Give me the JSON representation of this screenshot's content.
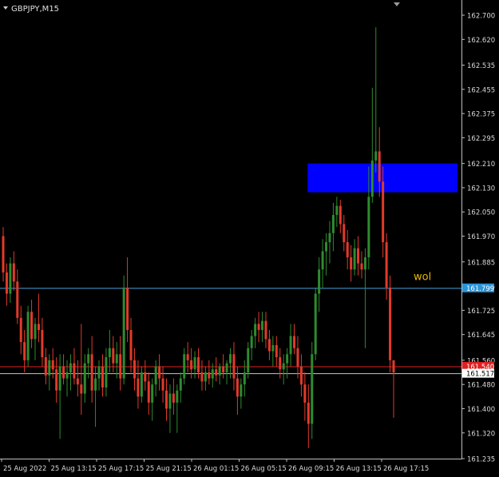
{
  "window": {
    "symbol_title": "GBPJPY,M15"
  },
  "colors": {
    "background": "#000000",
    "axis": "#c0c0c0",
    "bull": "#2e8b2e",
    "bear": "#e23a2a",
    "zone": "#0000ff",
    "hline_blue": "#4aa3df",
    "hline_red": "#e02020",
    "hline_white": "#c8c8c8",
    "annotation": "#e8b800"
  },
  "chart_data": {
    "type": "candlestick",
    "title": "GBPJPY,M15",
    "x_tick_labels": [
      "25 Aug 2022",
      "25 Aug 13:15",
      "25 Aug 17:15",
      "25 Aug 21:15",
      "26 Aug 01:15",
      "26 Aug 05:15",
      "26 Aug 09:15",
      "26 Aug 13:15",
      "26 Aug 17:15"
    ],
    "y_tick_labels": [
      "162.700",
      "162.620",
      "162.535",
      "162.455",
      "162.375",
      "162.295",
      "162.210",
      "162.130",
      "162.050",
      "161.970",
      "161.885",
      "161.805",
      "161.725",
      "161.645",
      "161.560",
      "161.480",
      "161.400",
      "161.320",
      "161.235"
    ],
    "ylim": [
      161.235,
      162.7
    ],
    "grid": false,
    "zone": {
      "y_top": 162.21,
      "y_bottom": 162.115,
      "from_index": 86,
      "to_end": true
    },
    "price_lines": [
      {
        "name": "level-blue",
        "value": 161.799,
        "label": "161.799",
        "color_key": "hline_blue"
      },
      {
        "name": "level-red",
        "value": 161.54,
        "label": "161.540",
        "color_key": "hline_red"
      },
      {
        "name": "level-white",
        "value": 161.517,
        "label": "161.517",
        "color_key": "hline_white"
      }
    ],
    "annotation": {
      "text": "wol",
      "value": 161.83,
      "index": 124
    },
    "candles": [
      {
        "o": 161.97,
        "h": 162.0,
        "l": 161.82,
        "c": 161.85
      },
      {
        "o": 161.85,
        "h": 161.88,
        "l": 161.74,
        "c": 161.78
      },
      {
        "o": 161.78,
        "h": 161.9,
        "l": 161.75,
        "c": 161.88
      },
      {
        "o": 161.88,
        "h": 161.92,
        "l": 161.79,
        "c": 161.82
      },
      {
        "o": 161.82,
        "h": 161.86,
        "l": 161.68,
        "c": 161.7
      },
      {
        "o": 161.7,
        "h": 161.74,
        "l": 161.58,
        "c": 161.62
      },
      {
        "o": 161.62,
        "h": 161.66,
        "l": 161.52,
        "c": 161.56
      },
      {
        "o": 161.56,
        "h": 161.74,
        "l": 161.54,
        "c": 161.72
      },
      {
        "o": 161.72,
        "h": 161.76,
        "l": 161.6,
        "c": 161.63
      },
      {
        "o": 161.63,
        "h": 161.7,
        "l": 161.56,
        "c": 161.68
      },
      {
        "o": 161.68,
        "h": 161.78,
        "l": 161.62,
        "c": 161.66
      },
      {
        "o": 161.66,
        "h": 161.7,
        "l": 161.54,
        "c": 161.57
      },
      {
        "o": 161.57,
        "h": 161.6,
        "l": 161.48,
        "c": 161.51
      },
      {
        "o": 161.51,
        "h": 161.58,
        "l": 161.46,
        "c": 161.56
      },
      {
        "o": 161.56,
        "h": 161.6,
        "l": 161.5,
        "c": 161.53
      },
      {
        "o": 161.53,
        "h": 161.57,
        "l": 161.42,
        "c": 161.46
      },
      {
        "o": 161.46,
        "h": 161.58,
        "l": 161.3,
        "c": 161.54
      },
      {
        "o": 161.54,
        "h": 161.58,
        "l": 161.48,
        "c": 161.5
      },
      {
        "o": 161.5,
        "h": 161.56,
        "l": 161.44,
        "c": 161.52
      },
      {
        "o": 161.52,
        "h": 161.58,
        "l": 161.46,
        "c": 161.55
      },
      {
        "o": 161.55,
        "h": 161.6,
        "l": 161.48,
        "c": 161.5
      },
      {
        "o": 161.5,
        "h": 161.56,
        "l": 161.44,
        "c": 161.48
      },
      {
        "o": 161.48,
        "h": 161.68,
        "l": 161.38,
        "c": 161.45
      },
      {
        "o": 161.45,
        "h": 161.58,
        "l": 161.42,
        "c": 161.55
      },
      {
        "o": 161.55,
        "h": 161.6,
        "l": 161.5,
        "c": 161.58
      },
      {
        "o": 161.58,
        "h": 161.64,
        "l": 161.42,
        "c": 161.46
      },
      {
        "o": 161.46,
        "h": 161.54,
        "l": 161.34,
        "c": 161.5
      },
      {
        "o": 161.5,
        "h": 161.56,
        "l": 161.46,
        "c": 161.54
      },
      {
        "o": 161.54,
        "h": 161.58,
        "l": 161.44,
        "c": 161.47
      },
      {
        "o": 161.47,
        "h": 161.6,
        "l": 161.44,
        "c": 161.57
      },
      {
        "o": 161.57,
        "h": 161.66,
        "l": 161.52,
        "c": 161.6
      },
      {
        "o": 161.6,
        "h": 161.64,
        "l": 161.52,
        "c": 161.55
      },
      {
        "o": 161.55,
        "h": 161.62,
        "l": 161.5,
        "c": 161.58
      },
      {
        "o": 161.58,
        "h": 161.64,
        "l": 161.46,
        "c": 161.5
      },
      {
        "o": 161.5,
        "h": 161.84,
        "l": 161.48,
        "c": 161.8
      },
      {
        "o": 161.8,
        "h": 161.9,
        "l": 161.62,
        "c": 161.66
      },
      {
        "o": 161.66,
        "h": 161.7,
        "l": 161.52,
        "c": 161.56
      },
      {
        "o": 161.56,
        "h": 161.6,
        "l": 161.46,
        "c": 161.5
      },
      {
        "o": 161.5,
        "h": 161.56,
        "l": 161.4,
        "c": 161.44
      },
      {
        "o": 161.44,
        "h": 161.54,
        "l": 161.42,
        "c": 161.52
      },
      {
        "o": 161.52,
        "h": 161.56,
        "l": 161.46,
        "c": 161.49
      },
      {
        "o": 161.49,
        "h": 161.52,
        "l": 161.38,
        "c": 161.42
      },
      {
        "o": 161.42,
        "h": 161.5,
        "l": 161.36,
        "c": 161.48
      },
      {
        "o": 161.48,
        "h": 161.56,
        "l": 161.44,
        "c": 161.54
      },
      {
        "o": 161.54,
        "h": 161.58,
        "l": 161.46,
        "c": 161.5
      },
      {
        "o": 161.5,
        "h": 161.54,
        "l": 161.42,
        "c": 161.46
      },
      {
        "o": 161.46,
        "h": 161.5,
        "l": 161.36,
        "c": 161.4
      },
      {
        "o": 161.4,
        "h": 161.48,
        "l": 161.32,
        "c": 161.45
      },
      {
        "o": 161.45,
        "h": 161.5,
        "l": 161.38,
        "c": 161.42
      },
      {
        "o": 161.42,
        "h": 161.48,
        "l": 161.32,
        "c": 161.46
      },
      {
        "o": 161.46,
        "h": 161.52,
        "l": 161.42,
        "c": 161.5
      },
      {
        "o": 161.5,
        "h": 161.6,
        "l": 161.48,
        "c": 161.58
      },
      {
        "o": 161.58,
        "h": 161.62,
        "l": 161.52,
        "c": 161.56
      },
      {
        "o": 161.56,
        "h": 161.6,
        "l": 161.5,
        "c": 161.53
      },
      {
        "o": 161.53,
        "h": 161.59,
        "l": 161.5,
        "c": 161.57
      },
      {
        "o": 161.57,
        "h": 161.6,
        "l": 161.5,
        "c": 161.52
      },
      {
        "o": 161.52,
        "h": 161.56,
        "l": 161.46,
        "c": 161.49
      },
      {
        "o": 161.49,
        "h": 161.54,
        "l": 161.46,
        "c": 161.52
      },
      {
        "o": 161.52,
        "h": 161.56,
        "l": 161.48,
        "c": 161.5
      },
      {
        "o": 161.5,
        "h": 161.55,
        "l": 161.47,
        "c": 161.53
      },
      {
        "o": 161.53,
        "h": 161.57,
        "l": 161.49,
        "c": 161.51
      },
      {
        "o": 161.51,
        "h": 161.55,
        "l": 161.48,
        "c": 161.54
      },
      {
        "o": 161.54,
        "h": 161.58,
        "l": 161.5,
        "c": 161.52
      },
      {
        "o": 161.52,
        "h": 161.56,
        "l": 161.48,
        "c": 161.55
      },
      {
        "o": 161.55,
        "h": 161.6,
        "l": 161.5,
        "c": 161.58
      },
      {
        "o": 161.58,
        "h": 161.62,
        "l": 161.46,
        "c": 161.5
      },
      {
        "o": 161.5,
        "h": 161.54,
        "l": 161.38,
        "c": 161.44
      },
      {
        "o": 161.44,
        "h": 161.5,
        "l": 161.4,
        "c": 161.48
      },
      {
        "o": 161.48,
        "h": 161.56,
        "l": 161.44,
        "c": 161.52
      },
      {
        "o": 161.52,
        "h": 161.62,
        "l": 161.5,
        "c": 161.6
      },
      {
        "o": 161.6,
        "h": 161.66,
        "l": 161.56,
        "c": 161.64
      },
      {
        "o": 161.64,
        "h": 161.7,
        "l": 161.6,
        "c": 161.68
      },
      {
        "o": 161.68,
        "h": 161.72,
        "l": 161.62,
        "c": 161.66
      },
      {
        "o": 161.66,
        "h": 161.72,
        "l": 161.62,
        "c": 161.69
      },
      {
        "o": 161.69,
        "h": 161.72,
        "l": 161.6,
        "c": 161.63
      },
      {
        "o": 161.63,
        "h": 161.66,
        "l": 161.56,
        "c": 161.59
      },
      {
        "o": 161.59,
        "h": 161.64,
        "l": 161.54,
        "c": 161.61
      },
      {
        "o": 161.61,
        "h": 161.64,
        "l": 161.54,
        "c": 161.57
      },
      {
        "o": 161.57,
        "h": 161.6,
        "l": 161.5,
        "c": 161.53
      },
      {
        "o": 161.53,
        "h": 161.58,
        "l": 161.48,
        "c": 161.55
      },
      {
        "o": 161.55,
        "h": 161.6,
        "l": 161.5,
        "c": 161.58
      },
      {
        "o": 161.58,
        "h": 161.68,
        "l": 161.54,
        "c": 161.64
      },
      {
        "o": 161.64,
        "h": 161.68,
        "l": 161.58,
        "c": 161.6
      },
      {
        "o": 161.6,
        "h": 161.64,
        "l": 161.5,
        "c": 161.54
      },
      {
        "o": 161.54,
        "h": 161.58,
        "l": 161.44,
        "c": 161.48
      },
      {
        "o": 161.48,
        "h": 161.52,
        "l": 161.36,
        "c": 161.42
      },
      {
        "o": 161.42,
        "h": 161.48,
        "l": 161.27,
        "c": 161.35
      },
      {
        "o": 161.35,
        "h": 161.62,
        "l": 161.3,
        "c": 161.58
      },
      {
        "o": 161.58,
        "h": 161.8,
        "l": 161.56,
        "c": 161.78
      },
      {
        "o": 161.78,
        "h": 161.9,
        "l": 161.72,
        "c": 161.86
      },
      {
        "o": 161.86,
        "h": 161.96,
        "l": 161.8,
        "c": 161.92
      },
      {
        "o": 161.92,
        "h": 161.98,
        "l": 161.84,
        "c": 161.95
      },
      {
        "o": 161.95,
        "h": 162.02,
        "l": 161.88,
        "c": 161.98
      },
      {
        "o": 161.98,
        "h": 162.08,
        "l": 161.92,
        "c": 162.04
      },
      {
        "o": 162.04,
        "h": 162.1,
        "l": 162.0,
        "c": 162.07
      },
      {
        "o": 162.07,
        "h": 162.09,
        "l": 161.98,
        "c": 162.01
      },
      {
        "o": 162.01,
        "h": 162.04,
        "l": 161.92,
        "c": 161.95
      },
      {
        "o": 161.95,
        "h": 161.99,
        "l": 161.86,
        "c": 161.9
      },
      {
        "o": 161.9,
        "h": 161.94,
        "l": 161.82,
        "c": 161.86
      },
      {
        "o": 161.86,
        "h": 161.96,
        "l": 161.84,
        "c": 161.93
      },
      {
        "o": 161.93,
        "h": 161.97,
        "l": 161.84,
        "c": 161.88
      },
      {
        "o": 161.88,
        "h": 161.92,
        "l": 161.83,
        "c": 161.86
      },
      {
        "o": 161.86,
        "h": 161.93,
        "l": 161.6,
        "c": 161.9
      },
      {
        "o": 161.9,
        "h": 162.2,
        "l": 161.86,
        "c": 162.1
      },
      {
        "o": 162.1,
        "h": 162.46,
        "l": 162.08,
        "c": 162.22
      },
      {
        "o": 162.22,
        "h": 162.66,
        "l": 162.18,
        "c": 162.25
      },
      {
        "o": 162.25,
        "h": 162.33,
        "l": 162.1,
        "c": 162.15
      },
      {
        "o": 162.15,
        "h": 162.2,
        "l": 161.9,
        "c": 161.95
      },
      {
        "o": 161.95,
        "h": 161.98,
        "l": 161.76,
        "c": 161.8
      },
      {
        "o": 161.8,
        "h": 161.84,
        "l": 161.52,
        "c": 161.56
      },
      {
        "o": 161.56,
        "h": 161.56,
        "l": 161.37,
        "c": 161.52
      }
    ]
  }
}
